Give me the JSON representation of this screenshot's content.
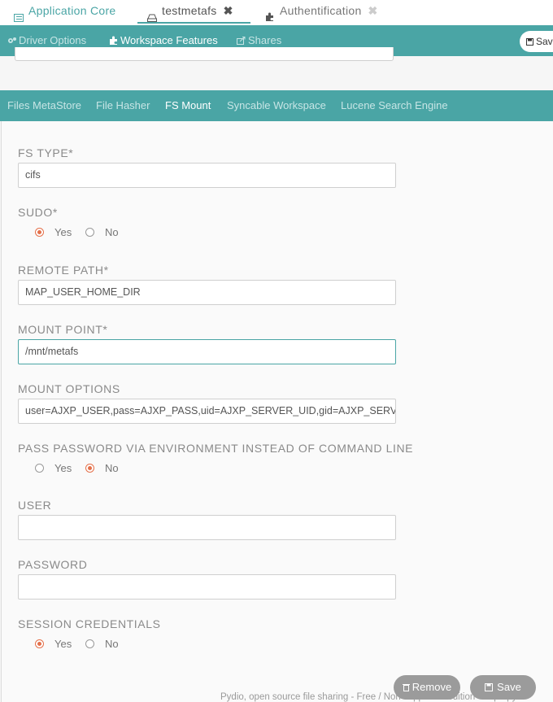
{
  "top_tabs": [
    {
      "label": "Application Core",
      "icon": "list-icon"
    },
    {
      "label": "testmetafs",
      "icon": "drive-icon",
      "close": "✖"
    },
    {
      "label": "Authentification",
      "icon": "puzzle-icon",
      "close": "✖"
    }
  ],
  "toolbar": {
    "driver_options": "Driver Options",
    "workspace_features": "Workspace Features",
    "shares": "Shares",
    "save": "Sav"
  },
  "sub_tabs": [
    "Files MetaStore",
    "File Hasher",
    "FS Mount",
    "Syncable Workspace",
    "Lucene Search Engine"
  ],
  "form": {
    "fs_type": {
      "label": "FS TYPE*",
      "value": "cifs"
    },
    "sudo": {
      "label": "SUDO*",
      "yes": "Yes",
      "no": "No",
      "selected": "Yes"
    },
    "remote_path": {
      "label": "REMOTE PATH*",
      "value": "MAP_USER_HOME_DIR"
    },
    "mount_point": {
      "label": "MOUNT POINT*",
      "value": "/mnt/metafs"
    },
    "mount_options": {
      "label": "MOUNT OPTIONS",
      "value": "user=AJXP_USER,pass=AJXP_PASS,uid=AJXP_SERVER_UID,gid=AJXP_SERVER_GID"
    },
    "pass_env": {
      "label": "PASS PASSWORD VIA ENVIRONMENT INSTEAD OF COMMAND LINE",
      "yes": "Yes",
      "no": "No",
      "selected": "No"
    },
    "user": {
      "label": "USER",
      "value": ""
    },
    "password": {
      "label": "PASSWORD",
      "value": ""
    },
    "session_credentials": {
      "label": "SESSION CREDENTIALS",
      "yes": "Yes",
      "no": "No",
      "selected": "Yes"
    }
  },
  "buttons": {
    "remove": "Remove",
    "save": "Save"
  },
  "footer": "Pydio, open source file sharing - Free / Non supported edition - http://pyd",
  "colors": {
    "teal": "#4aa5a5",
    "radio_selected": "#e4704a",
    "button_gray": "#9b9b9b"
  }
}
